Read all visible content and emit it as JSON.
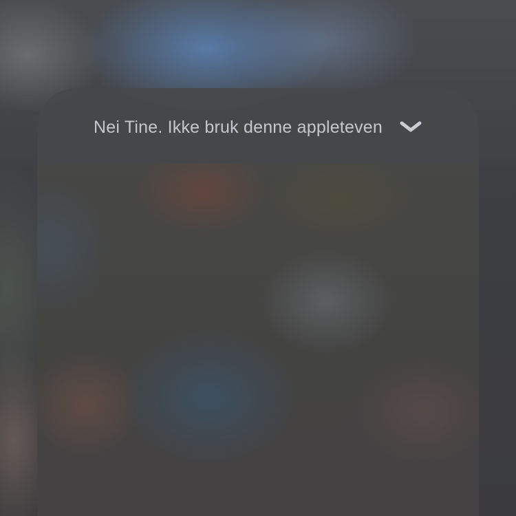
{
  "notification": {
    "title": "Nei Tine. Ikke bruk denne appleteven",
    "toggle_icon": "chevron-down-icon"
  },
  "colors": {
    "title_text": "#c4c7cc",
    "chevron": "#c9ccd1",
    "divider": "#a8a8ad"
  }
}
